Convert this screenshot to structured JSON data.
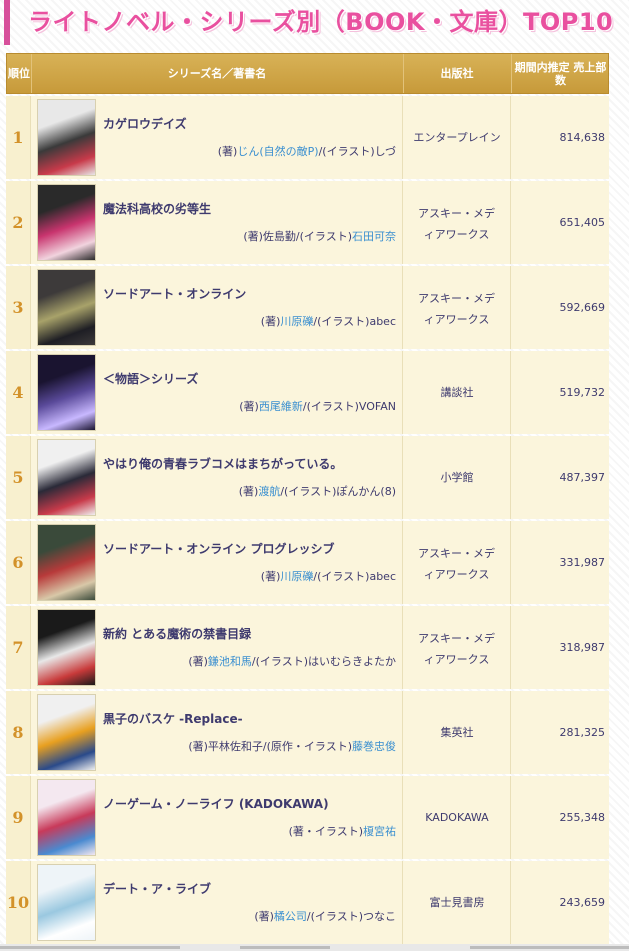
{
  "page": {
    "title": "ライトノベル・シリーズ別（BOOK・文庫）TOP10",
    "accent": "#e9509f",
    "header_color": "#c99d3e",
    "row_bg": "#fbf5dc",
    "rank_color": "#d3922a",
    "text_color": "#3e3a6e",
    "link_color": "#3a8fd0"
  },
  "columns": {
    "rank": "順位",
    "series": "シリーズ名／著書名",
    "publisher": "出版社",
    "sales": "期間内推定 売上部数"
  },
  "rows": [
    {
      "rank": "1",
      "series": "カゲロウデイズ",
      "author_pre": "(著)",
      "author_link": "じん(自然の敵P)",
      "author_post": "/(イラスト)しづ",
      "publisher": "エンタープレイン",
      "sales": "814,638",
      "cover_colors": [
        "#e8e8e8",
        "#3a3a3a",
        "#c83a4a"
      ]
    },
    {
      "rank": "2",
      "series": "魔法科高校の劣等生",
      "author_pre": "(著)佐島勤/(イラスト)",
      "author_link": "石田可奈",
      "author_post": "",
      "publisher": "アスキー・メディアワークス",
      "sales": "651,405",
      "cover_colors": [
        "#2a2a2a",
        "#c8346e",
        "#f1d3de"
      ]
    },
    {
      "rank": "3",
      "series": "ソードアート・オンライン",
      "author_pre": "(著)",
      "author_link": "川原礫",
      "author_post": "/(イラスト)abec",
      "publisher": "アスキー・メディアワークス",
      "sales": "592,669",
      "cover_colors": [
        "#3d3a3a",
        "#a8a26a",
        "#1e1e24"
      ]
    },
    {
      "rank": "4",
      "series": "＜物語＞シリーズ",
      "author_pre": "(著)",
      "author_link": "西尾維新",
      "author_post": "/(イラスト)VOFAN",
      "publisher": "講談社",
      "sales": "519,732",
      "cover_colors": [
        "#1a1430",
        "#5a4a9a",
        "#c8b8ff"
      ]
    },
    {
      "rank": "5",
      "series": "やはり俺の青春ラブコメはまちがっている。",
      "author_pre": "(著)",
      "author_link": "渡航",
      "author_post": "/(イラスト)ぽんかん(8)",
      "publisher": "小学館",
      "sales": "487,397",
      "cover_colors": [
        "#f0f0f0",
        "#2a2a38",
        "#c83a4a"
      ]
    },
    {
      "rank": "6",
      "series": "ソードアート・オンライン プログレッシブ",
      "author_pre": "(著)",
      "author_link": "川原礫",
      "author_post": "/(イラスト)abec",
      "publisher": "アスキー・メディアワークス",
      "sales": "331,987",
      "cover_colors": [
        "#3a4a3a",
        "#b83a3a",
        "#d8c8a8"
      ]
    },
    {
      "rank": "7",
      "series": "新約 とある魔術の禁書目録",
      "author_pre": "(著)",
      "author_link": "鎌池和馬",
      "author_post": "/(イラスト)はいむらきよたか",
      "publisher": "アスキー・メディアワークス",
      "sales": "318,987",
      "cover_colors": [
        "#1a1a1a",
        "#e8e8e8",
        "#c83a3a"
      ]
    },
    {
      "rank": "8",
      "series": "黒子のバスケ -Replace-",
      "author_pre": "(著)平林佐和子/(原作・イラスト)",
      "author_link": "藤巻忠俊",
      "author_post": "",
      "publisher": "集英社",
      "sales": "281,325",
      "cover_colors": [
        "#f0f0f0",
        "#e8a020",
        "#2a4a8a"
      ]
    },
    {
      "rank": "9",
      "series": "ノーゲーム・ノーライフ (KADOKAWA)",
      "author_pre": "(著・イラスト)",
      "author_link": "榎宮祐",
      "author_post": "",
      "publisher": "KADOKAWA",
      "sales": "255,348",
      "cover_colors": [
        "#f4e8f0",
        "#c83a5a",
        "#4a8ad0"
      ]
    },
    {
      "rank": "10",
      "series": "デート・ア・ライブ",
      "author_pre": "(著)",
      "author_link": "橘公司",
      "author_post": "/(イラスト)つなこ",
      "publisher": "富士見書房",
      "sales": "243,659",
      "cover_colors": [
        "#eef4f8",
        "#9ac8e0",
        "#ffffff"
      ]
    }
  ]
}
